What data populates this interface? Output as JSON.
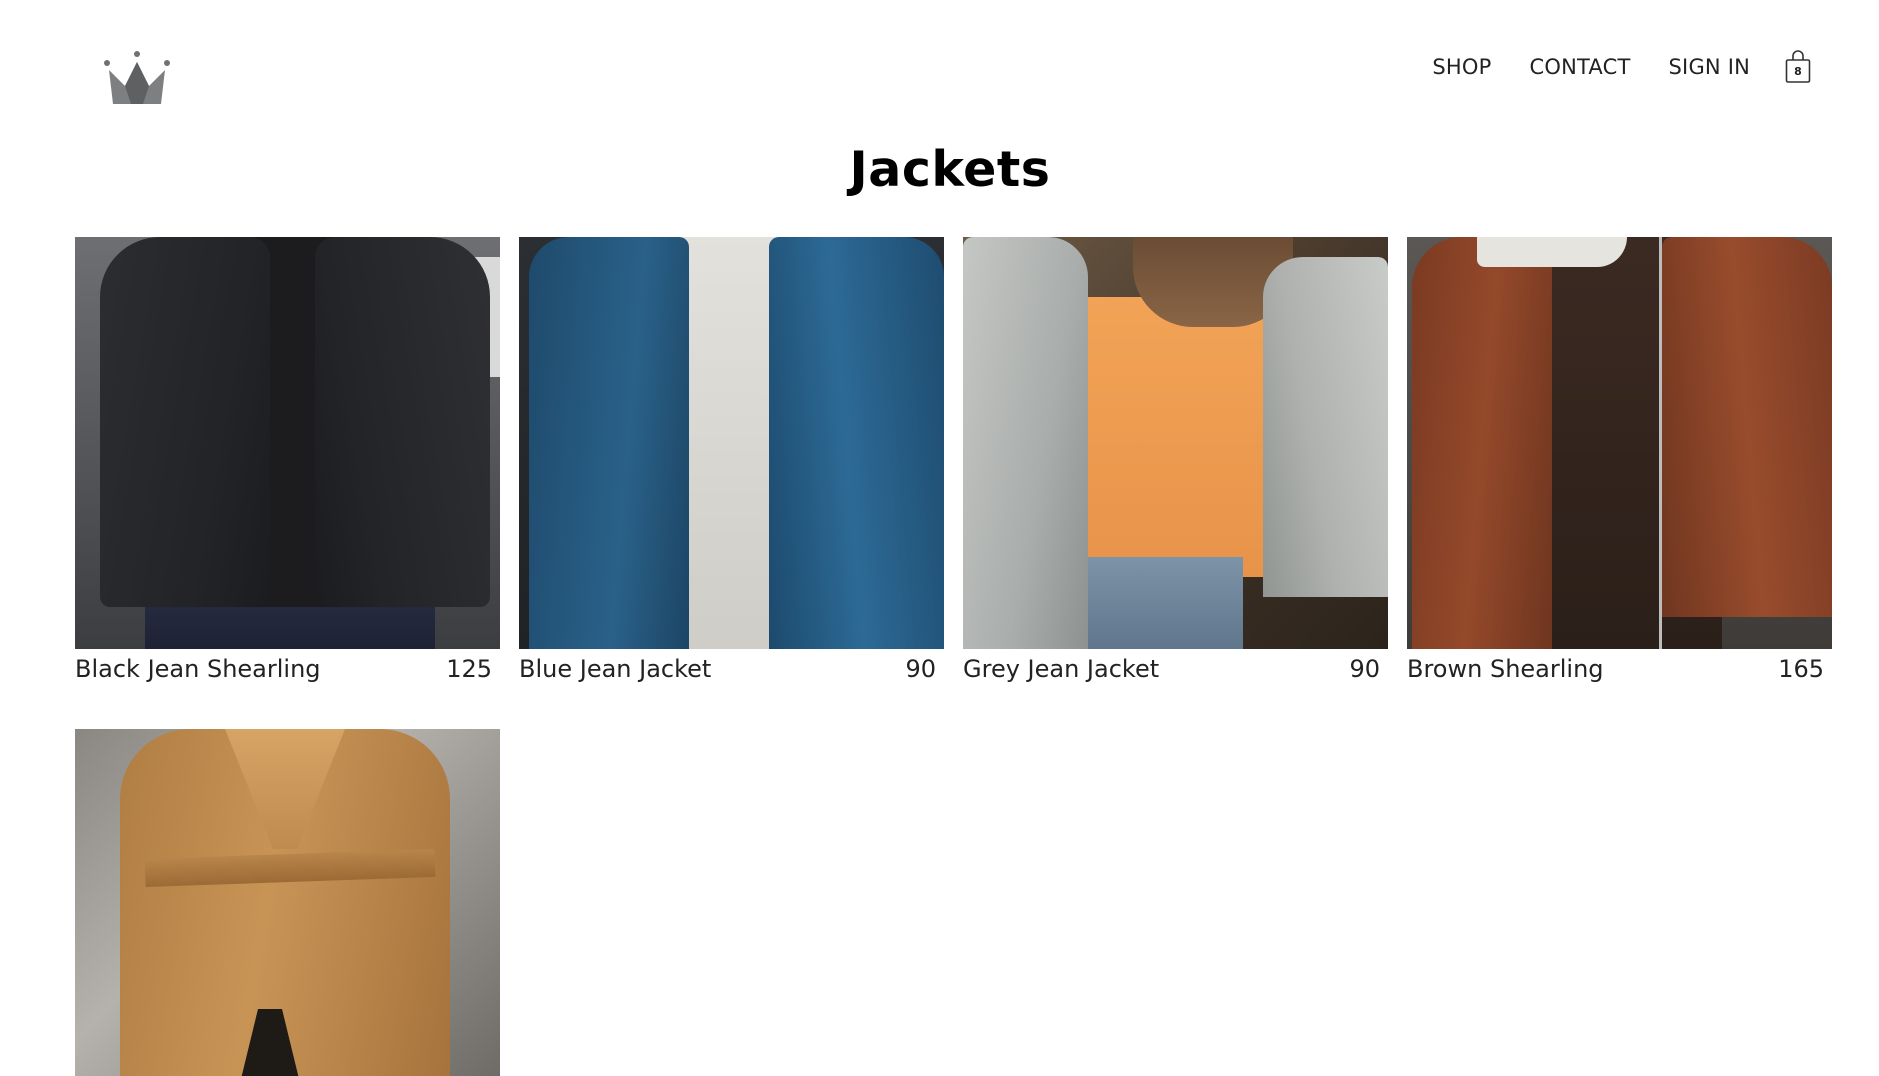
{
  "header": {
    "logo_icon": "crown-icon",
    "nav": [
      {
        "label": "SHOP"
      },
      {
        "label": "CONTACT"
      },
      {
        "label": "SIGN IN"
      }
    ],
    "cart": {
      "icon": "shopping-bag-icon",
      "count": "8"
    }
  },
  "page": {
    "title": "Jackets"
  },
  "products": [
    {
      "name": "Black Jean Shearling",
      "price": "125"
    },
    {
      "name": "Blue Jean Jacket",
      "price": "90"
    },
    {
      "name": "Grey Jean Jacket",
      "price": "90"
    },
    {
      "name": "Brown Shearling",
      "price": "165"
    },
    {
      "name": "",
      "price": ""
    }
  ],
  "colors": {
    "text": "#222222",
    "title": "#000000",
    "logo": "#6f7173",
    "background": "#ffffff"
  }
}
